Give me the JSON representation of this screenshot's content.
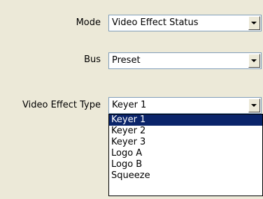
{
  "form": {
    "mode": {
      "label": "Mode",
      "value": "Video Effect Status"
    },
    "bus": {
      "label": "Bus",
      "value": "Preset"
    },
    "video_effect_type": {
      "label": "Video Effect Type",
      "value": "Keyer 1",
      "options": [
        "Keyer 1",
        "Keyer 2",
        "Keyer 3",
        "Logo A",
        "Logo B",
        "Squeeze"
      ],
      "highlighted_index": 0
    }
  },
  "icons": {
    "combo_button": "chevron-down-icon"
  }
}
